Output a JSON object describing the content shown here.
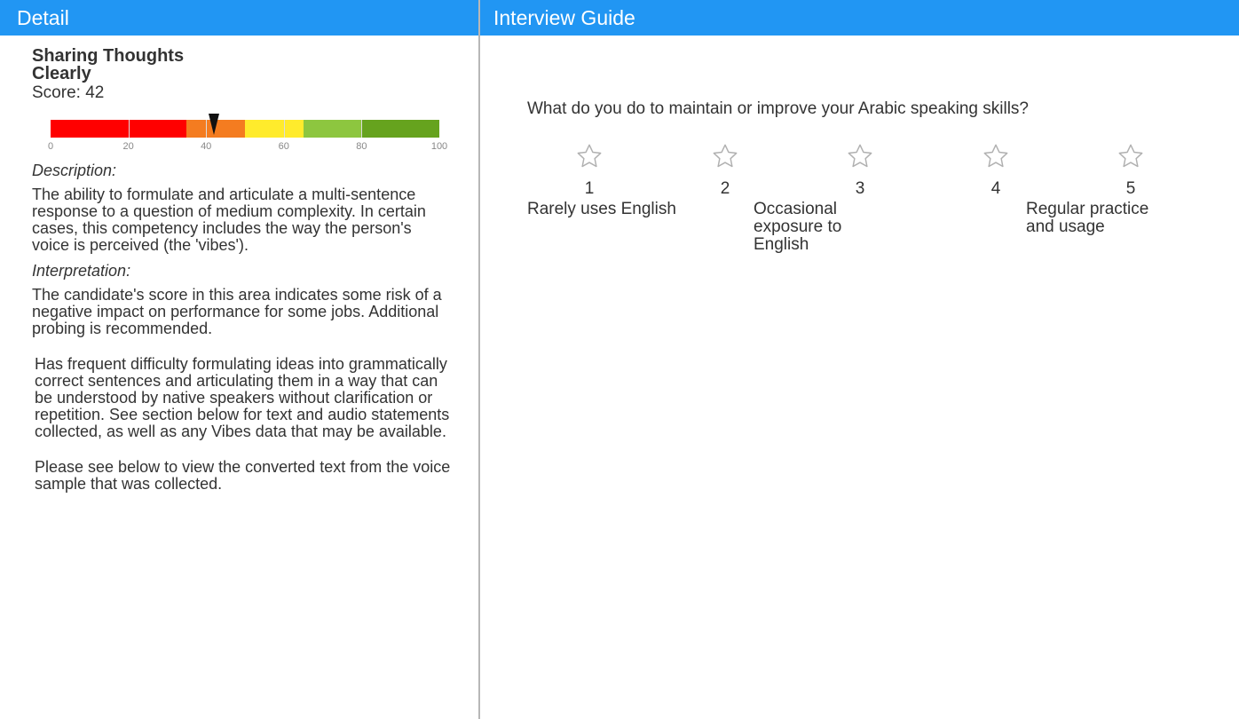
{
  "header": {
    "left_title": "Detail",
    "right_title": "Interview Guide"
  },
  "detail": {
    "competency_line1": "Sharing Thoughts",
    "competency_line2": "Clearly",
    "score_text": "Score: 42",
    "score_value": 42,
    "scale": {
      "min": 0,
      "max": 100,
      "tick_labels": [
        "0",
        "20",
        "40",
        "60",
        "80",
        "100"
      ],
      "bands": [
        {
          "from": 0,
          "to": 35,
          "color": "#ff0000"
        },
        {
          "from": 35,
          "to": 50,
          "color": "#f47c20"
        },
        {
          "from": 50,
          "to": 65,
          "color": "#ffeb2c"
        },
        {
          "from": 65,
          "to": 80,
          "color": "#8dc63f"
        },
        {
          "from": 80,
          "to": 100,
          "color": "#66a31e"
        }
      ]
    },
    "description_label": "Description:",
    "description_text": "The ability to formulate and articulate a multi-sentence response to a question of medium complexity. In certain cases, this competency includes the way the person's voice is perceived (the 'vibes').",
    "interpretation_label": "Interpretation:",
    "interpretation_text": "The candidate's score in this area indicates some risk of a negative impact on performance for some jobs. Additional probing is recommended.",
    "detail_text": "Has frequent difficulty formulating ideas into grammatically correct sentences and articulating them in a way that can be understood by native speakers without clarification or repetition. See section below for text and audio statements collected, as well as any Vibes data that may be available.",
    "voice_text": "Please see below to view the converted text from the voice sample that was collected."
  },
  "guide": {
    "question": "What do you do to maintain or improve your Arabic speaking skills?",
    "ratings": [
      "1",
      "2",
      "3",
      "4",
      "5"
    ],
    "star_icon": "star-outline-icon",
    "anchors": {
      "low": "Rarely uses English",
      "mid": "Occasional exposure to English",
      "high": "Regular practice and usage"
    }
  }
}
